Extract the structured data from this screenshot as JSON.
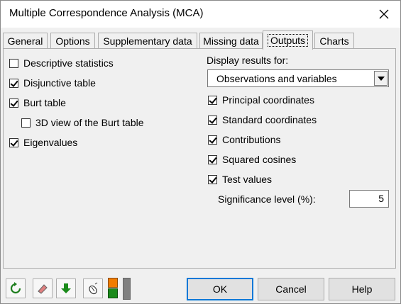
{
  "window": {
    "title": "Multiple Correspondence Analysis (MCA)"
  },
  "tabs": [
    "General",
    "Options",
    "Supplementary data",
    "Missing data",
    "Outputs",
    "Charts"
  ],
  "active_tab": "Outputs",
  "left_options": [
    {
      "label": "Descriptive statistics",
      "checked": false
    },
    {
      "label": "Disjunctive table",
      "checked": true
    },
    {
      "label": "Burt table",
      "checked": true
    },
    {
      "label": "3D view of the Burt table",
      "checked": false
    },
    {
      "label": "Eigenvalues",
      "checked": true
    }
  ],
  "display": {
    "label": "Display results for:",
    "selected": "Observations and variables"
  },
  "right_options": [
    {
      "label": "Principal coordinates",
      "checked": true
    },
    {
      "label": "Standard coordinates",
      "checked": true
    },
    {
      "label": "Contributions",
      "checked": true
    },
    {
      "label": "Squared cosines",
      "checked": true
    },
    {
      "label": "Test values",
      "checked": true
    }
  ],
  "significance": {
    "label": "Significance level (%):",
    "value": "5"
  },
  "buttons": {
    "ok": "OK",
    "cancel": "Cancel",
    "help": "Help"
  },
  "colors": {
    "accent": "#0078d7",
    "refresh_green": "#1e7e1e",
    "download_green": "#1a8a1a",
    "orange": "#f07c00"
  }
}
